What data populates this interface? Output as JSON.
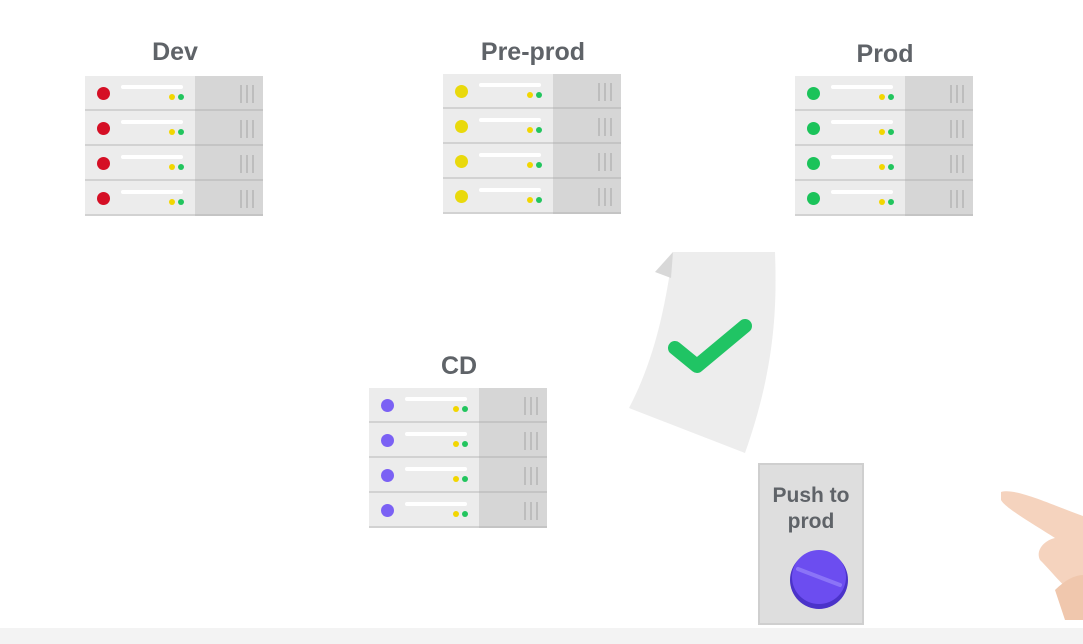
{
  "stacks": {
    "dev": {
      "title": "Dev",
      "led_color": "#d50f25"
    },
    "preprod": {
      "title": "Pre-prod",
      "led_color": "#e9d90c"
    },
    "prod": {
      "title": "Prod",
      "led_color": "#1bc35a"
    },
    "cd": {
      "title": "CD",
      "led_color": "#7b61f4"
    }
  },
  "document": {
    "icon": "checkmark-icon",
    "check_color": "#20c464"
  },
  "push_button": {
    "label": "Push to prod",
    "knob_color": "#6c4df0",
    "icon": "push-button-icon"
  },
  "hand": {
    "icon": "hand-icon"
  }
}
